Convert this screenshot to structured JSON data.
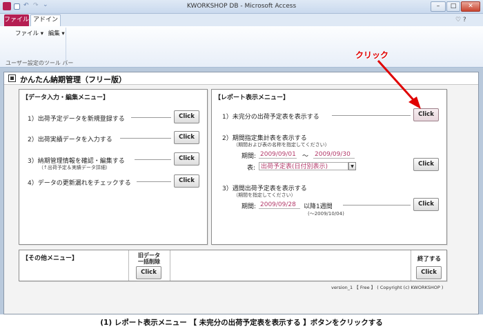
{
  "window": {
    "title": "KWORKSHOP DB - Microsoft Access",
    "min": "–",
    "max": "□",
    "close": "✕",
    "help": "♡ ?"
  },
  "ribbon": {
    "tabs": [
      "ファイル",
      "アドイン"
    ],
    "menu_file": "ファイル ▾",
    "menu_edit": "編集 ▾",
    "group_label": "ユーザー設定のツール バー"
  },
  "form": {
    "title": "かんたん納期管理（フリー版）",
    "data_panel": {
      "title": "【データ入力・編集メニュー】",
      "items": [
        {
          "label": "1）出荷予定データを新規登録する",
          "button": "Click"
        },
        {
          "label": "2）出荷実績データを入力する",
          "button": "Click"
        },
        {
          "label": "3）納期管理情報を確認・編集する",
          "sub": "（↑出荷予定＆実績データ詳細）",
          "button": "Click"
        },
        {
          "label": "4）データの更新漏れをチェックする",
          "button": "Click"
        }
      ]
    },
    "report_panel": {
      "title": "【レポート表示メニュー】",
      "item1": {
        "label": "1）未完分の出荷予定表を表示する",
        "button": "Click"
      },
      "item2": {
        "label": "2）期間指定集計表を表示する",
        "sub": "（期間および表の名称を指定してください）",
        "period_label": "期間:",
        "date_from": "2009/09/01",
        "tilde": "〜",
        "date_to": "2009/09/30",
        "table_label": "表:",
        "table_value": "出荷予定表(日付別表示)",
        "button": "Click"
      },
      "item3": {
        "label": "3）週間出荷予定表を表示する",
        "sub": "（期間を指定してください）",
        "period_label": "期間:",
        "date": "2009/09/28",
        "after_text": "以降1週間",
        "range_note": "(〜2009/10/04)",
        "button": "Click"
      }
    },
    "other_panel": {
      "title": "【その他メニュー】"
    },
    "old_data": {
      "label_line1": "旧データ",
      "label_line2": "一括削除",
      "button": "Click"
    },
    "exit": {
      "label": "終了する",
      "button": "Click"
    },
    "version": "version_1 【 Free 】 ( Copyright (c) KWORKSHOP )"
  },
  "annotation": {
    "text": "クリック",
    "color": "#e00000"
  },
  "caption": "(1) レポート表示メニュー 【 未完分の出荷予定表を表示する 】ボタンをクリックする"
}
